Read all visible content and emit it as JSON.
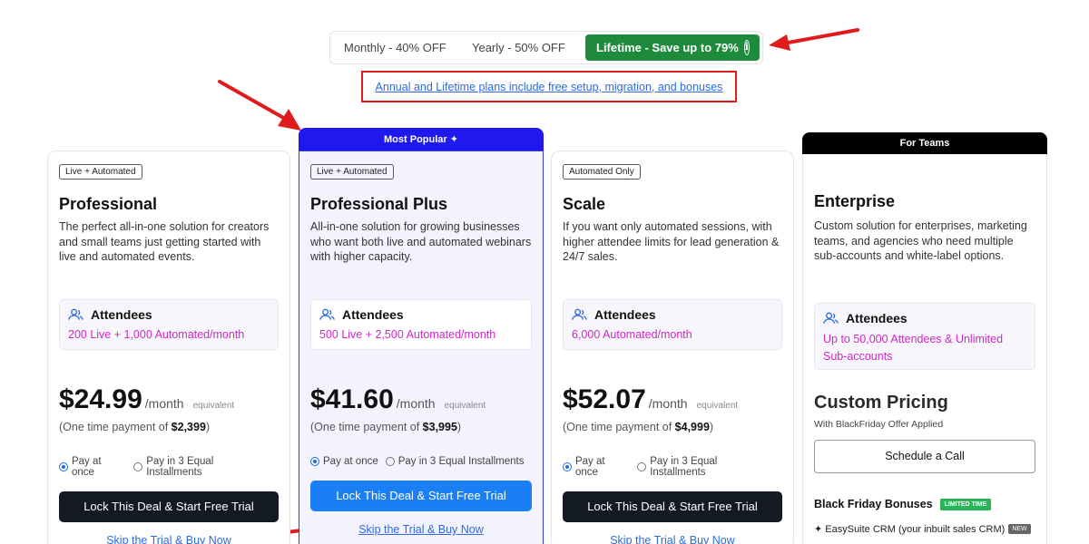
{
  "toggle": {
    "monthly": "Monthly - 40% OFF",
    "yearly": "Yearly - 50% OFF",
    "lifetime": "Lifetime - Save up to 79%",
    "info_glyph": "i"
  },
  "notice": "Annual and Lifetime plans include free setup, migration, and bonuses",
  "popular_label": "Most Popular",
  "teams_label": "For Teams",
  "plans": [
    {
      "tag": "Live + Automated",
      "name": "Professional",
      "desc": "The perfect all-in-one solution for creators and small teams just getting started with live and automated events.",
      "att_label": "Attendees",
      "att_value": "200 Live + 1,000 Automated/month",
      "price": "$24.99",
      "per": "/month",
      "equiv": "equivalent",
      "onetime_prefix": "(One time payment of ",
      "onetime_amount": "$2,399",
      "onetime_suffix": ")",
      "pay_once": "Pay at once",
      "pay_install": "Pay in 3 Equal Installments",
      "cta": "Lock This Deal & Start Free Trial",
      "skip": "Skip the Trial & Buy Now"
    },
    {
      "tag": "Live + Automated",
      "name": "Professional Plus",
      "desc": "All-in-one solution for growing businesses who want both live and automated webinars with higher capacity.",
      "att_label": "Attendees",
      "att_value": "500 Live + 2,500 Automated/month",
      "price": "$41.60",
      "per": "/month",
      "equiv": "equivalent",
      "onetime_prefix": "(One time payment of ",
      "onetime_amount": "$3,995",
      "onetime_suffix": ")",
      "pay_once": "Pay at once",
      "pay_install": "Pay in 3 Equal Installments",
      "cta": "Lock This Deal & Start Free Trial",
      "skip": "Skip the Trial & Buy Now"
    },
    {
      "tag": "Automated Only",
      "name": "Scale",
      "desc": "If you want only automated sessions, with higher attendee limits for lead generation & 24/7 sales.",
      "att_label": "Attendees",
      "att_value": "6,000 Automated/month",
      "price": "$52.07",
      "per": "/month",
      "equiv": "equivalent",
      "onetime_prefix": "(One time payment of ",
      "onetime_amount": "$4,999",
      "onetime_suffix": ")",
      "pay_once": "Pay at once",
      "pay_install": "Pay in 3 Equal Installments",
      "cta": "Lock This Deal & Start Free Trial",
      "skip": "Skip the Trial & Buy Now"
    }
  ],
  "enterprise": {
    "name": "Enterprise",
    "desc": "Custom solution for enterprises, marketing teams, and agencies who need multiple sub-accounts and white-label options.",
    "att_label": "Attendees",
    "att_value": "Up to 50,000 Attendees & Unlimited Sub-accounts",
    "custom_price": "Custom Pricing",
    "offer": "With BlackFriday Offer Applied",
    "schedule": "Schedule a Call",
    "bonus_title": "Black Friday Bonuses",
    "bonus_badge": "LIMITED TIME",
    "bonus_item": "✦ EasySuite CRM (your inbuilt sales CRM)",
    "bonus_item_badge": "NEW"
  },
  "colors": {
    "lifetime_green": "#1e8a3b",
    "popular_blue": "#1f19f0",
    "cta_dark": "#141a24",
    "cta_blue": "#1a7ff2",
    "attendee_magenta": "#d027c8",
    "annotation_red": "#e01b1b"
  }
}
